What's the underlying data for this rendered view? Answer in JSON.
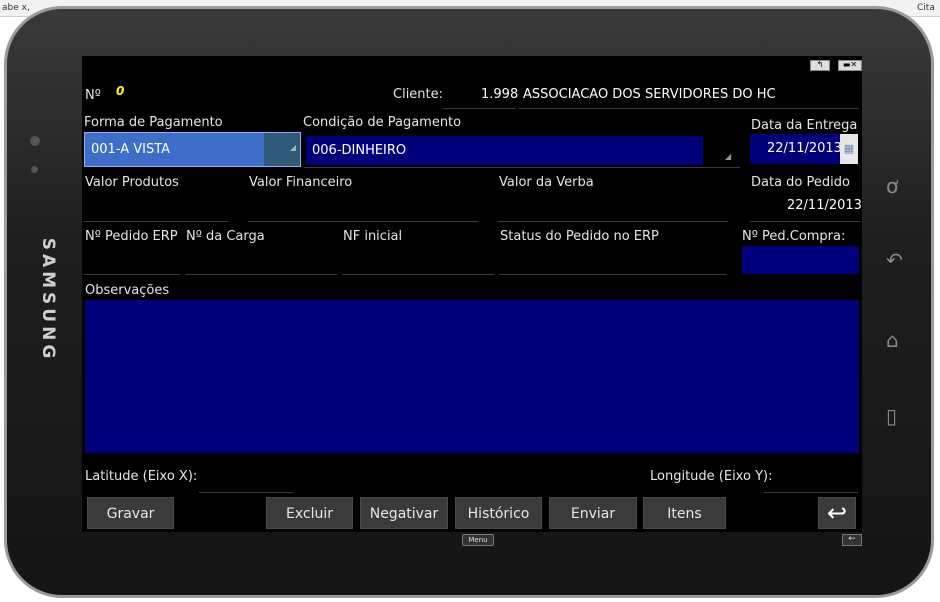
{
  "browser": {
    "left_text": "abe  x,",
    "right_text": "Cita"
  },
  "device": {
    "brand": "SAMSUNG"
  },
  "header": {
    "numero_label": "Nº",
    "numero_value": "0",
    "cliente_label": "Cliente:",
    "cliente_code": "1.998",
    "cliente_name": "ASSOCIACAO DOS SERVIDORES DO HC"
  },
  "form": {
    "forma_pagamento_label": "Forma de Pagamento",
    "forma_pagamento_value": "001-A VISTA",
    "condicao_pagamento_label": "Condição de Pagamento",
    "condicao_pagamento_value": "006-DINHEIRO",
    "data_entrega_label": "Data da Entrega",
    "data_entrega_value": "22/11/2013",
    "valor_produtos_label": "Valor Produtos",
    "valor_financeiro_label": "Valor Financeiro",
    "valor_verba_label": "Valor da Verba",
    "data_pedido_label": "Data do Pedido",
    "data_pedido_value": "22/11/2013",
    "pedido_erp_label": "Nº Pedido ERP",
    "carga_label": "Nº da Carga",
    "nf_inicial_label": "NF inicial",
    "status_erp_label": "Status do Pedido no ERP",
    "ped_compra_label": "Nº Ped.Compra:",
    "observacoes_label": "Observações",
    "latitude_label": "Latitude (Eixo X):",
    "longitude_label": "Longitude (Eixo Y):"
  },
  "buttons": {
    "gravar": "Gravar",
    "excluir": "Excluir",
    "negativar": "Negativar",
    "historico": "Histórico",
    "enviar": "Enviar",
    "itens": "Itens"
  },
  "softkeys": {
    "menu": "Menu"
  },
  "colors": {
    "screen_bg": "#000000",
    "field_navy": "#00007a",
    "combo_blue": "#3d6ec8",
    "value_yellow": "#ffff00"
  }
}
